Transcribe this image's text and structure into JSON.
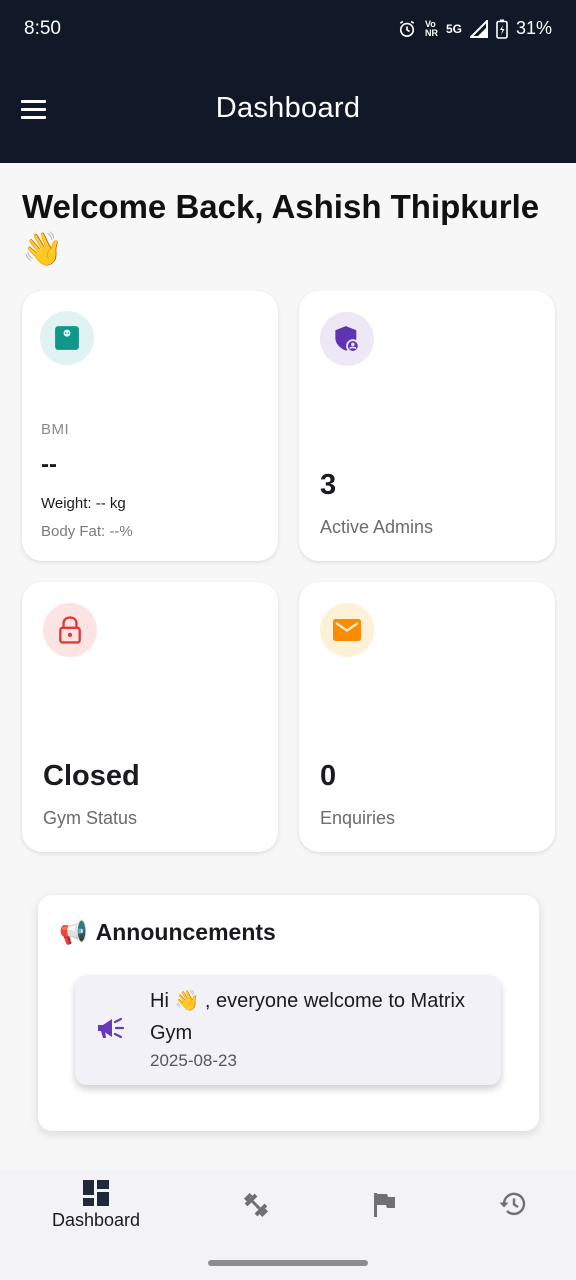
{
  "status_bar": {
    "time": "8:50",
    "network_vo": "Vo",
    "network_nr": "NR",
    "network_type": "5G",
    "battery": "31%"
  },
  "app_bar": {
    "title": "Dashboard",
    "menu_icon": "menu-icon"
  },
  "welcome": {
    "text": "Welcome Back, Ashish Thipkurle",
    "emoji": "👋"
  },
  "cards": {
    "bmi": {
      "label": "BMI",
      "value": "--",
      "weight": "Weight: -- kg",
      "body_fat": "Body Fat: --%",
      "icon": "scale-icon",
      "icon_bg": "#e0f2f1",
      "icon_color": "#10968a"
    },
    "admins": {
      "value": "3",
      "label": "Active Admins",
      "icon": "admin-shield-icon",
      "icon_bg": "#ede7f6",
      "icon_color": "#5e35b1"
    },
    "gym_status": {
      "value": "Closed",
      "label": "Gym Status",
      "icon": "lock-icon",
      "icon_bg": "#fde4e4",
      "icon_color": "#e53935"
    },
    "enquiries": {
      "value": "0",
      "label": "Enquiries",
      "icon": "mail-icon",
      "icon_bg": "#fff1d6",
      "icon_color": "#fb8c00"
    }
  },
  "announcements": {
    "title": "Announcements",
    "title_emoji": "📢",
    "items": [
      {
        "message": "Hi 👋 , everyone welcome to Matrix Gym",
        "date": "2025-08-23",
        "icon": "megaphone-icon",
        "icon_color": "#673ab7"
      }
    ]
  },
  "bottom_nav": {
    "items": [
      {
        "label": "Dashboard",
        "icon": "dashboard-icon",
        "active": true
      },
      {
        "label": "",
        "icon": "dumbbell-icon",
        "active": false
      },
      {
        "label": "",
        "icon": "flag-icon",
        "active": false
      },
      {
        "label": "",
        "icon": "history-icon",
        "active": false
      }
    ]
  }
}
